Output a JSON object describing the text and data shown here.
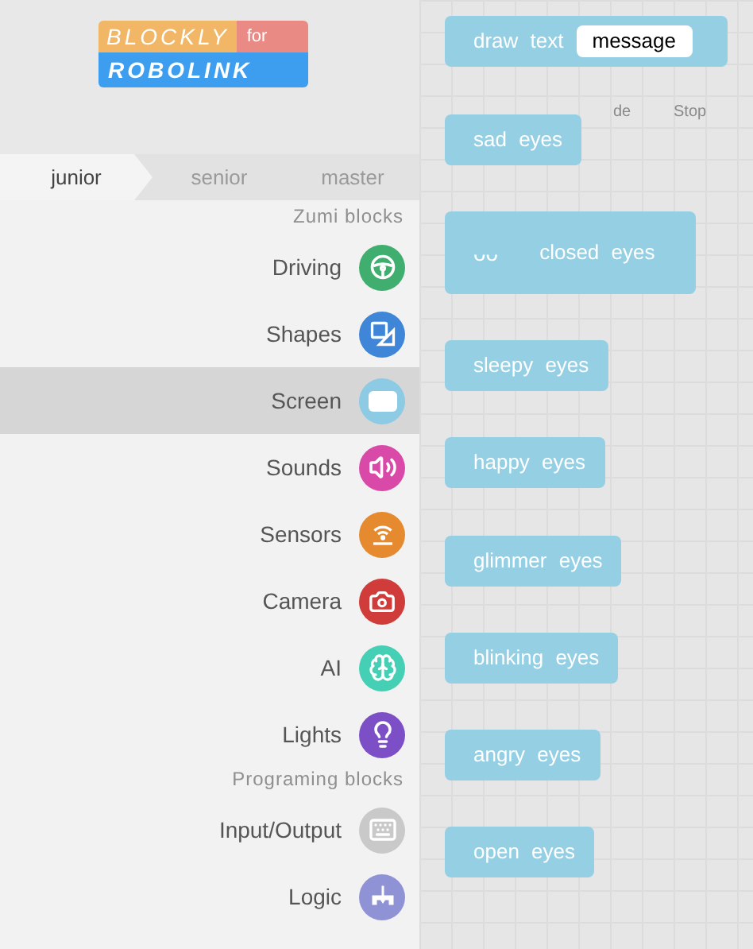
{
  "logo": {
    "top": "BLOCKLY",
    "for": "for",
    "bottom": "ROBOLINK"
  },
  "tabs": [
    {
      "label": "junior",
      "selected": true
    },
    {
      "label": "senior",
      "selected": false
    },
    {
      "label": "master",
      "selected": false
    }
  ],
  "sections": [
    {
      "heading": "Zumi blocks",
      "categories": [
        {
          "label": "Driving",
          "color": "#3fae6e",
          "selected": false
        },
        {
          "label": "Shapes",
          "color": "#3f86d8",
          "selected": false
        },
        {
          "label": "Screen",
          "color": "#8ccbe3",
          "selected": true
        },
        {
          "label": "Sounds",
          "color": "#d94aa8",
          "selected": false
        },
        {
          "label": "Sensors",
          "color": "#e58a2e",
          "selected": false
        },
        {
          "label": "Camera",
          "color": "#cf3c3a",
          "selected": false
        },
        {
          "label": "AI",
          "color": "#45cfb4",
          "selected": false
        },
        {
          "label": "Lights",
          "color": "#7c4fc6",
          "selected": false
        }
      ]
    },
    {
      "heading": "Programing blocks",
      "categories": [
        {
          "label": "Input/Output",
          "color": "#c9c9c9",
          "selected": false
        },
        {
          "label": "Logic",
          "color": "#8f93d6",
          "selected": false
        }
      ]
    }
  ],
  "toolbar_behind": {
    "run_label": "de",
    "stop_label": "Stop"
  },
  "blocks": [
    {
      "kind": "field",
      "label": "draw text",
      "value": "message"
    },
    {
      "kind": "plain",
      "label": "sad eyes"
    },
    {
      "kind": "icon",
      "icon_text": "ᴗᴗ",
      "label": "closed eyes"
    },
    {
      "kind": "plain",
      "label": "sleepy eyes"
    },
    {
      "kind": "plain",
      "label": "happy eyes"
    },
    {
      "kind": "plain",
      "label": "glimmer eyes"
    },
    {
      "kind": "plain",
      "label": "blinking eyes"
    },
    {
      "kind": "plain",
      "label": "angry eyes"
    },
    {
      "kind": "plain",
      "label": "open eyes"
    }
  ]
}
